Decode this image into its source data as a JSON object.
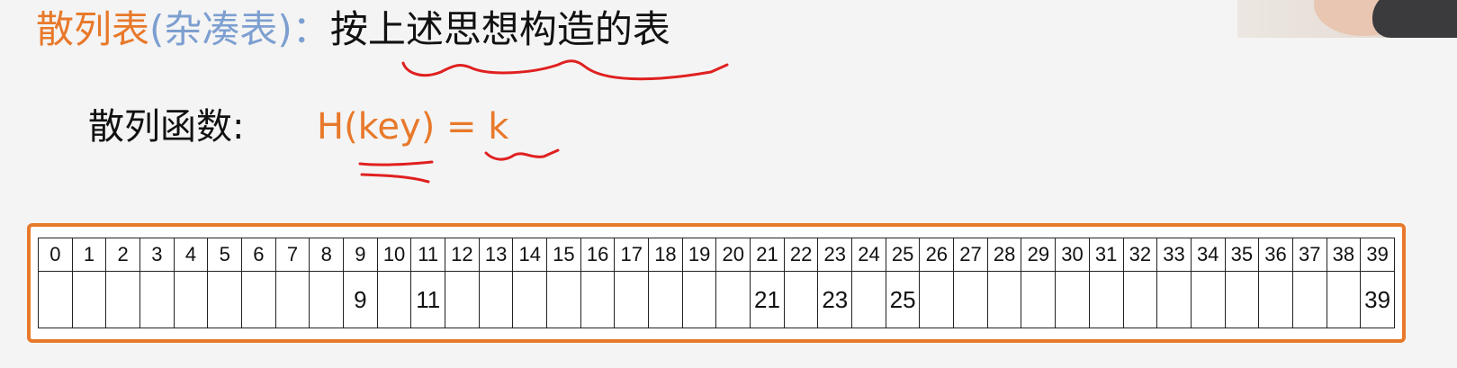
{
  "title": {
    "part1": "散列表",
    "part2": "(杂凑表)",
    "part3": "：",
    "part4": "按上述思想构造的表"
  },
  "hash_function": {
    "label": "散列函数:",
    "formula": "H(key) = k"
  },
  "colors": {
    "orange": "#e8792a",
    "blue": "#7d9fd0",
    "annotation_red": "#e02020"
  },
  "table": {
    "indices": [
      "0",
      "1",
      "2",
      "3",
      "4",
      "5",
      "6",
      "7",
      "8",
      "9",
      "10",
      "11",
      "12",
      "13",
      "14",
      "15",
      "16",
      "17",
      "18",
      "19",
      "20",
      "21",
      "22",
      "23",
      "24",
      "25",
      "26",
      "27",
      "28",
      "29",
      "30",
      "31",
      "32",
      "33",
      "34",
      "35",
      "36",
      "37",
      "38",
      "39"
    ],
    "values": [
      "",
      "",
      "",
      "",
      "",
      "",
      "",
      "",
      "",
      "9",
      "",
      "11",
      "",
      "",
      "",
      "",
      "",
      "",
      "",
      "",
      "",
      "21",
      "",
      "23",
      "",
      "25",
      "",
      "",
      "",
      "",
      "",
      "",
      "",
      "",
      "",
      "",
      "",
      "",
      "",
      "39"
    ]
  }
}
